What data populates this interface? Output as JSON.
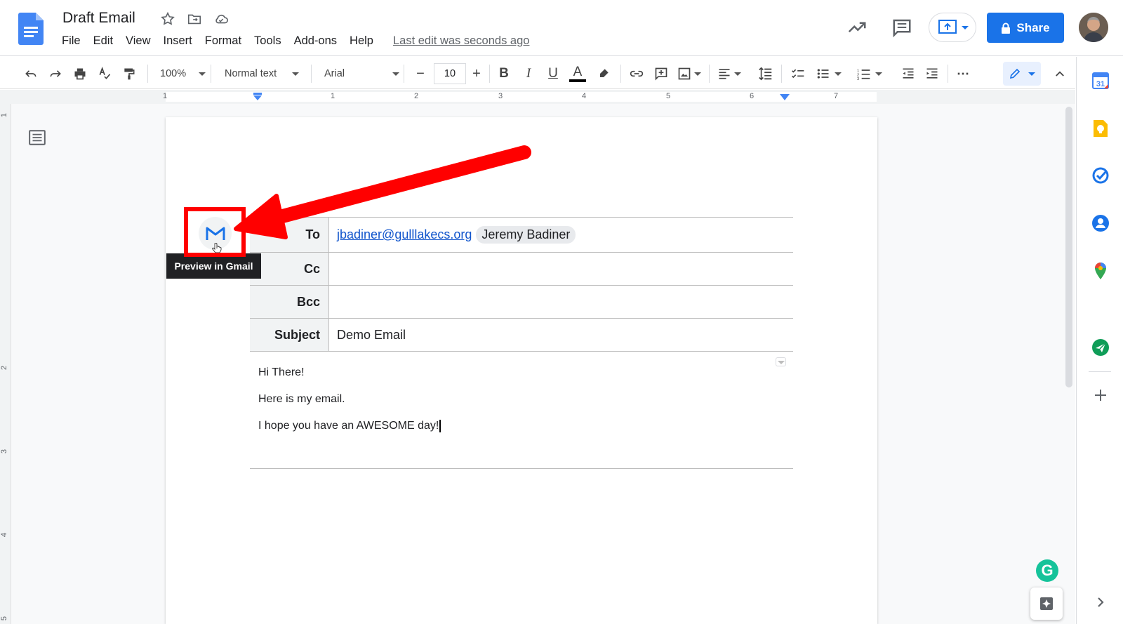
{
  "header": {
    "doc_title": "Draft Email",
    "menus": [
      "File",
      "Edit",
      "View",
      "Insert",
      "Format",
      "Tools",
      "Add-ons",
      "Help"
    ],
    "last_edit": "Last edit was seconds ago",
    "share_label": "Share"
  },
  "toolbar": {
    "zoom": "100%",
    "style": "Normal text",
    "font": "Arial",
    "font_size": "10"
  },
  "ruler": {
    "h_ticks": [
      "1",
      "1",
      "2",
      "3",
      "4",
      "5",
      "6",
      "7"
    ],
    "v_ticks": [
      "1",
      "2",
      "3",
      "4",
      "5"
    ]
  },
  "email": {
    "rows": [
      {
        "label": "To",
        "link": "jbadiner@gulllakecs.org",
        "chip": "Jeremy Badiner"
      },
      {
        "label": "Cc",
        "value": ""
      },
      {
        "label": "Bcc",
        "value": ""
      },
      {
        "label": "Subject",
        "value": "Demo Email"
      }
    ],
    "body": [
      "Hi There!",
      "Here is my email.",
      "I hope you have an AWESOME day!"
    ]
  },
  "tooltip": "Preview in Gmail",
  "colors": {
    "accent": "#1a73e8",
    "annotation": "#ff0000",
    "grammarly": "#15c39a"
  },
  "icons": [
    "docs-logo-icon",
    "star-icon",
    "move-folder-icon",
    "cloud-icon",
    "trending-icon",
    "comment-icon",
    "present-icon",
    "lock-icon",
    "undo-icon",
    "redo-icon",
    "print-icon",
    "spellcheck-icon",
    "paint-format-icon",
    "bold-icon",
    "italic-icon",
    "underline-icon",
    "text-color-icon",
    "highlight-icon",
    "link-icon",
    "add-comment-icon",
    "image-icon",
    "align-icon",
    "line-spacing-icon",
    "checklist-icon",
    "bullet-list-icon",
    "numbered-list-icon",
    "indent-decrease-icon",
    "indent-increase-icon",
    "more-icon",
    "edit-mode-icon",
    "collapse-icon",
    "outline-icon",
    "gmail-icon",
    "calendar-icon",
    "keep-icon",
    "tasks-icon",
    "contacts-icon",
    "maps-icon",
    "addon-icon",
    "plus-icon",
    "chevron-right-icon",
    "grammarly-icon",
    "explore-icon"
  ]
}
